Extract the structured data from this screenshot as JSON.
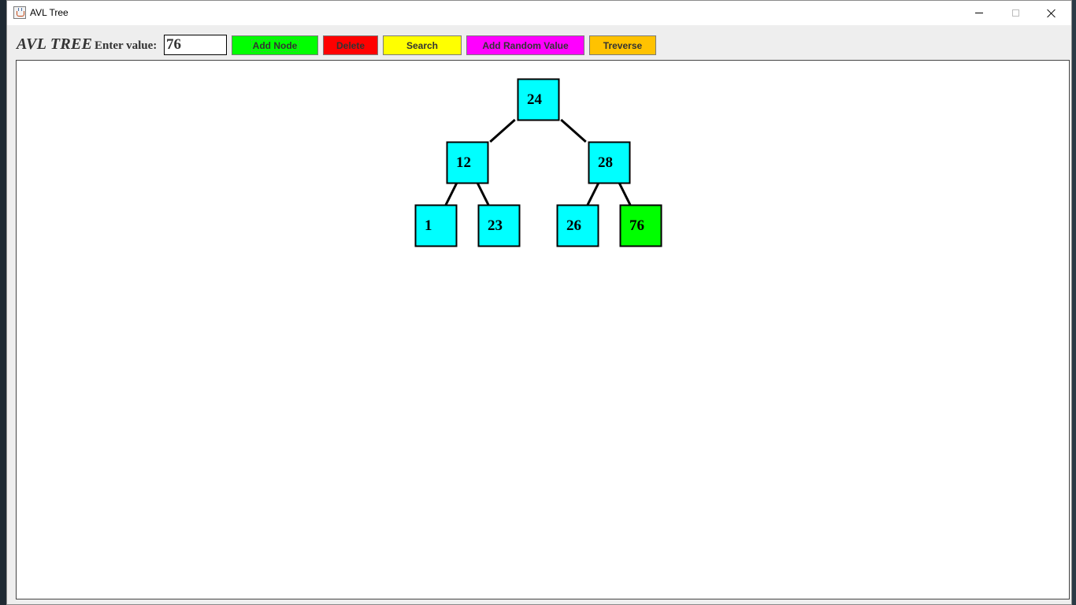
{
  "window": {
    "title": "AVL Tree"
  },
  "toolbar": {
    "brand": "AVL TREE",
    "enter_label": "Enter value:",
    "input_value": "76",
    "buttons": {
      "add": "Add Node",
      "delete": "Delete",
      "search": "Search",
      "random": "Add Random Value",
      "traverse": "Treverse"
    }
  },
  "colors": {
    "node_fill": "#00ffff",
    "highlight_fill": "#00ff00",
    "add_button": "#00ff00",
    "delete_button": "#ff0000",
    "search_button": "#ffff00",
    "random_button": "#ff00ff",
    "traverse_button": "#ffc200"
  },
  "tree": {
    "highlighted": "76",
    "nodes": [
      {
        "id": "n24",
        "value": "24"
      },
      {
        "id": "n12",
        "value": "12"
      },
      {
        "id": "n28",
        "value": "28"
      },
      {
        "id": "n1",
        "value": "1"
      },
      {
        "id": "n23",
        "value": "23"
      },
      {
        "id": "n26",
        "value": "26"
      },
      {
        "id": "n76",
        "value": "76"
      }
    ],
    "edges": [
      [
        "n24",
        "n12"
      ],
      [
        "n24",
        "n28"
      ],
      [
        "n12",
        "n1"
      ],
      [
        "n12",
        "n23"
      ],
      [
        "n28",
        "n26"
      ],
      [
        "n28",
        "n76"
      ]
    ]
  }
}
